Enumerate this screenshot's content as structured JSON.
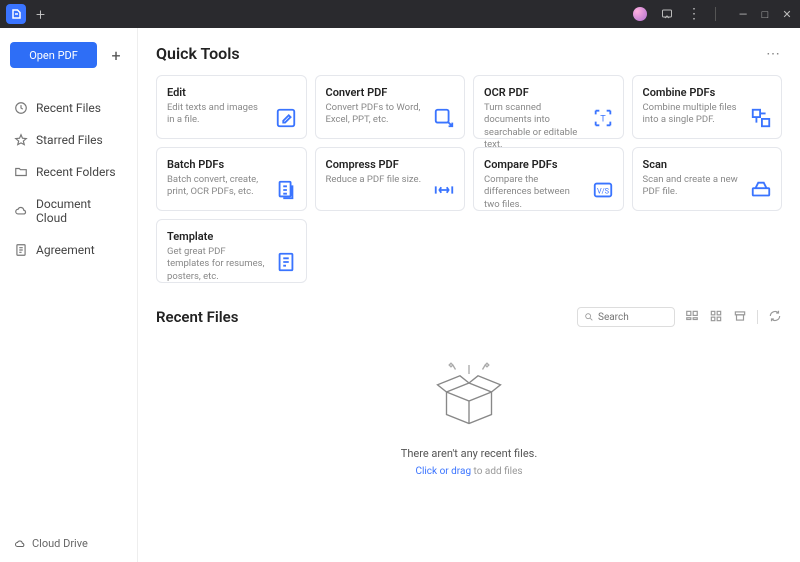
{
  "titlebar": {
    "window_controls": {
      "min": "—",
      "max": "□",
      "close": "✕"
    }
  },
  "sidebar": {
    "open_label": "Open PDF",
    "items": [
      {
        "label": "Recent Files"
      },
      {
        "label": "Starred Files"
      },
      {
        "label": "Recent Folders"
      },
      {
        "label": "Document Cloud"
      },
      {
        "label": "Agreement"
      }
    ],
    "cloud_drive": "Cloud Drive"
  },
  "quick_tools": {
    "heading": "Quick Tools",
    "cards": [
      {
        "title": "Edit",
        "desc": "Edit texts and images in a file."
      },
      {
        "title": "Convert PDF",
        "desc": "Convert PDFs to Word, Excel, PPT, etc."
      },
      {
        "title": "OCR PDF",
        "desc": "Turn scanned documents into searchable or editable text."
      },
      {
        "title": "Combine PDFs",
        "desc": "Combine multiple files into a single PDF."
      },
      {
        "title": "Batch PDFs",
        "desc": "Batch convert, create, print, OCR PDFs, etc."
      },
      {
        "title": "Compress PDF",
        "desc": "Reduce a PDF file size."
      },
      {
        "title": "Compare PDFs",
        "desc": "Compare the differences between two files."
      },
      {
        "title": "Scan",
        "desc": "Scan and create a new PDF file."
      },
      {
        "title": "Template",
        "desc": "Get great PDF templates for resumes, posters, etc."
      }
    ]
  },
  "recent": {
    "heading": "Recent Files",
    "search_placeholder": "Search",
    "empty_msg": "There aren't any recent files.",
    "hint_link": "Click or drag",
    "hint_rest": " to add files"
  }
}
